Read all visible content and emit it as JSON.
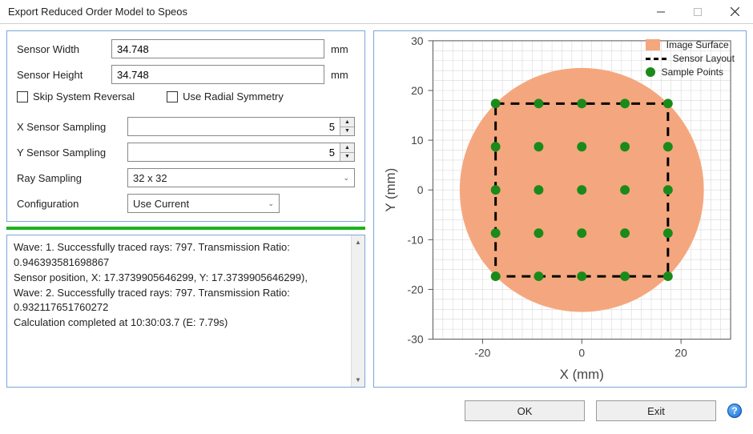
{
  "window": {
    "title": "Export Reduced Order Model to Speos"
  },
  "form": {
    "sensor_width_label": "Sensor Width",
    "sensor_width_value": "34.748",
    "sensor_width_unit": "mm",
    "sensor_height_label": "Sensor Height",
    "sensor_height_value": "34.748",
    "sensor_height_unit": "mm",
    "skip_reversal_label": "Skip System Reversal",
    "use_radial_symmetry_label": "Use Radial Symmetry",
    "x_sampling_label": "X Sensor Sampling",
    "x_sampling_value": "5",
    "y_sampling_label": "Y Sensor Sampling",
    "y_sampling_value": "5",
    "ray_sampling_label": "Ray Sampling",
    "ray_sampling_value": "32 x 32",
    "configuration_label": "Configuration",
    "configuration_value": "Use Current"
  },
  "log": {
    "text": "Wave: 1. Successfully traced rays: 797. Transmission Ratio: 0.946393581698867\nSensor position, X: 17.3739905646299, Y: 17.3739905646299),\nWave: 2. Successfully traced rays: 797. Transmission Ratio: 0.932117651760272\nCalculation completed at 10:30:03.7 (E: 7.79s)"
  },
  "buttons": {
    "ok": "OK",
    "exit": "Exit"
  },
  "legend": {
    "image_surface": "Image Surface",
    "sensor_layout": "Sensor Layout",
    "sample_points": "Sample Points"
  },
  "colors": {
    "image_surface": "#f4a77e",
    "sample_point": "#1a8a1a",
    "sensor_layout": "#000000"
  },
  "chart_data": {
    "type": "scatter",
    "title": "",
    "xlabel": "X (mm)",
    "ylabel": "Y (mm)",
    "xlim": [
      -30,
      30
    ],
    "ylim": [
      -30,
      30
    ],
    "xticks": [
      -20,
      0,
      20
    ],
    "yticks": [
      -30,
      -20,
      -10,
      0,
      10,
      20,
      30
    ],
    "image_surface": {
      "shape": "circle",
      "cx": 0,
      "cy": 0,
      "r": 24.6
    },
    "sensor_layout_rect": {
      "x0": -17.37,
      "y0": -17.37,
      "x1": 17.37,
      "y1": 17.37
    },
    "sample_points_grid": {
      "x_values": [
        -17.37,
        -8.69,
        0,
        8.69,
        17.37
      ],
      "y_values": [
        -17.37,
        -8.69,
        0,
        8.69,
        17.37
      ]
    }
  }
}
